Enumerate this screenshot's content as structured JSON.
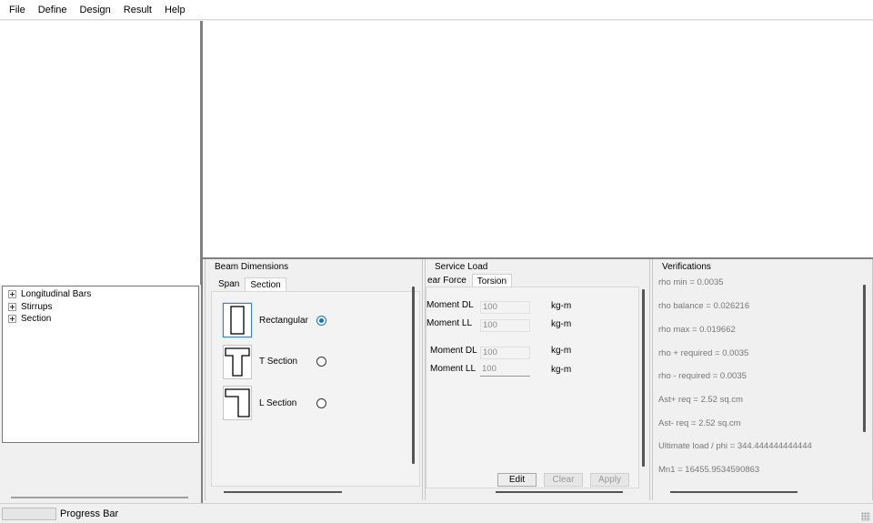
{
  "menu": [
    "File",
    "Define",
    "Design",
    "Result",
    "Help"
  ],
  "tree": {
    "items": [
      "Longitudinal Bars",
      "Stirrups",
      "Section"
    ]
  },
  "beam_dimensions": {
    "title": "Beam Dimensions",
    "tabs": [
      "Span",
      "Section"
    ],
    "active_tab": "Section",
    "shapes": [
      {
        "label": "Rectangular",
        "icon": "rectangular-section-icon",
        "selected": true
      },
      {
        "label": "T Section",
        "icon": "t-section-icon",
        "selected": false
      },
      {
        "label": "L Section",
        "icon": "l-section-icon",
        "selected": false
      }
    ]
  },
  "service_load": {
    "title": "Service Load",
    "tabs": [
      "ear Force",
      "Torsion"
    ],
    "active_tab": "Torsion",
    "rows": [
      {
        "label": "Moment DL",
        "value": "100",
        "unit": "kg-m"
      },
      {
        "label": "Moment LL",
        "value": "100",
        "unit": "kg-m"
      },
      {
        "label": "Moment DL",
        "value": "100",
        "unit": "kg-m"
      },
      {
        "label": "Moment LL",
        "value": "100",
        "unit": "kg-m"
      }
    ],
    "buttons": {
      "edit": "Edit",
      "clear": "Clear",
      "apply": "Apply"
    }
  },
  "verifications": {
    "title": "Verifications",
    "rows": [
      "rho min = 0.0035",
      "rho balance = 0.026216",
      "rho max = 0.019662",
      "rho + required = 0.0035",
      "rho - required = 0.0035",
      "Ast+ req = 2.52 sq.cm",
      "Ast- req = 2.52 sq.cm",
      "Ultimate load / phi = 344.444444444444",
      "Mn1 = 16455.9534590863"
    ]
  },
  "status": {
    "progress_label": "Progress Bar"
  },
  "colors": {
    "accent": "#1a6fb5",
    "selected_border": "#3c7fb1"
  }
}
